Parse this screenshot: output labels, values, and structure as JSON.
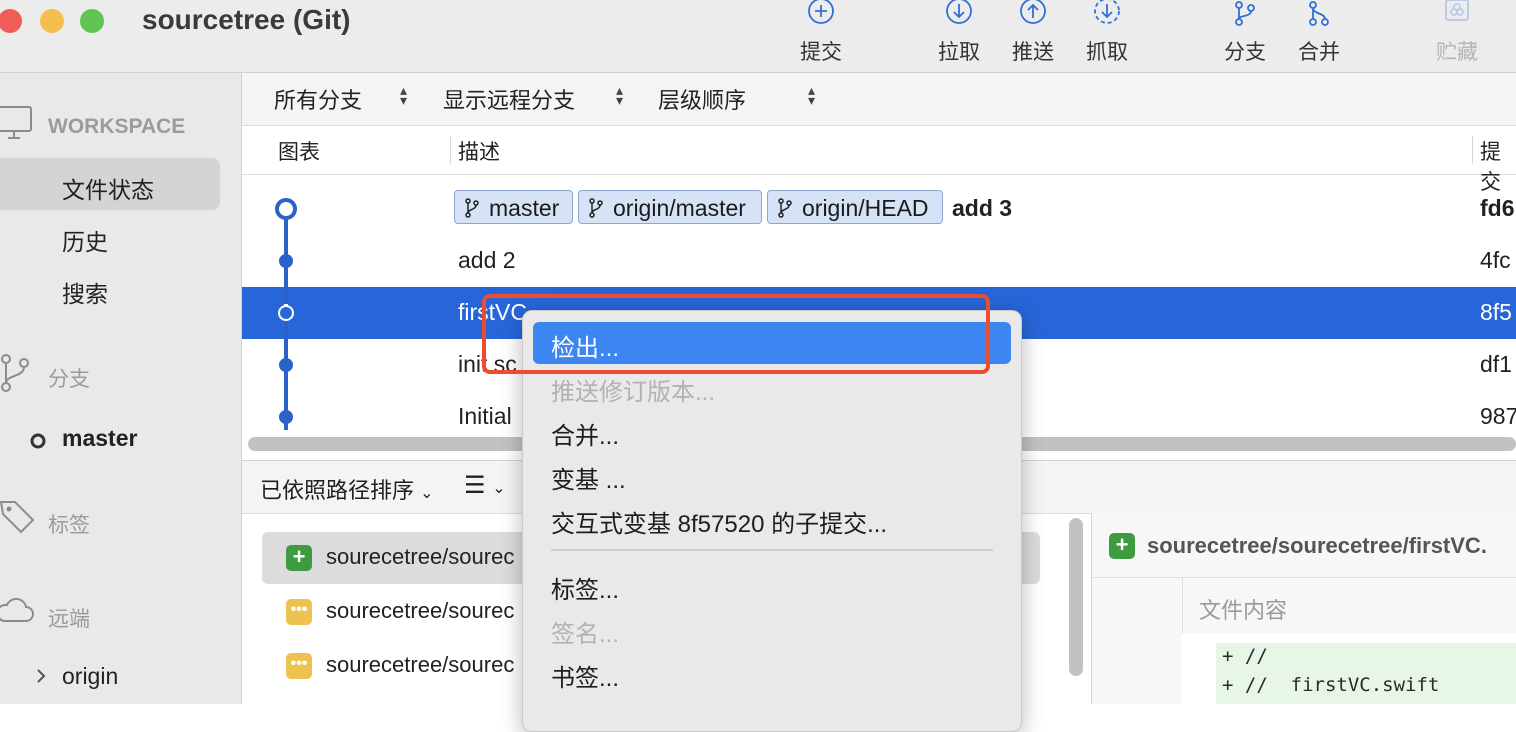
{
  "window": {
    "title": "sourcetree (Git)",
    "traffic_colors": {
      "close": "#ee5e56",
      "minimize": "#f4be4f",
      "zoom": "#5fc453"
    }
  },
  "toolbar": {
    "commit": "提交",
    "pull": "拉取",
    "push": "推送",
    "fetch": "抓取",
    "branch": "分支",
    "merge": "合并",
    "stash": "贮藏"
  },
  "sidebar": {
    "workspace_heading": "WORKSPACE",
    "workspace_items": [
      "文件状态",
      "历史",
      "搜索"
    ],
    "branches_heading": "分支",
    "current_branch": "master",
    "tags_heading": "标签",
    "remotes_heading": "远端",
    "remote_origin": "origin"
  },
  "filters": {
    "branches": "所有分支",
    "remote": "显示远程分支",
    "order": "层级顺序"
  },
  "columns": {
    "graph": "图表",
    "description": "描述",
    "commit": "提交"
  },
  "commits": [
    {
      "tags": [
        "master",
        "origin/master",
        "origin/HEAD"
      ],
      "description": "add 3",
      "hash": "fd6"
    },
    {
      "description": "add 2",
      "hash": "4fc"
    },
    {
      "description": "firstVC",
      "hash": "8f5"
    },
    {
      "description": "init sc",
      "hash": "df1"
    },
    {
      "description": "Initial",
      "hash": "987"
    }
  ],
  "bottom": {
    "sort_label": "已依照路径排序",
    "files": [
      {
        "name": "sourecetree/sourec",
        "status": "added"
      },
      {
        "name": "sourecetree/sourec",
        "status": "modified"
      },
      {
        "name": "sourecetree/sourec",
        "status": "modified"
      }
    ],
    "diff_file_title": "sourecetree/sourecetree/firstVC.",
    "diff_header": "文件内容",
    "diff_lines": [
      "+ //",
      "+ //  firstVC.swift"
    ]
  },
  "context_menu": {
    "items": [
      {
        "label": "检出...",
        "state": "highlighted"
      },
      {
        "label": "推送修订版本...",
        "state": "disabled"
      },
      {
        "label": "合并...",
        "state": "enabled"
      },
      {
        "label": "变基 ...",
        "state": "enabled"
      },
      {
        "label": "交互式变基 8f57520 的子提交...",
        "state": "enabled"
      },
      {
        "label": "标签...",
        "state": "enabled"
      },
      {
        "label": "签名...",
        "state": "disabled"
      },
      {
        "label": "书签...",
        "state": "enabled"
      }
    ]
  },
  "colors": {
    "selection": "#2766d8",
    "menu_highlight": "#3d86f2",
    "callout": "#ea4d2f",
    "graph": "#2a62c9"
  }
}
